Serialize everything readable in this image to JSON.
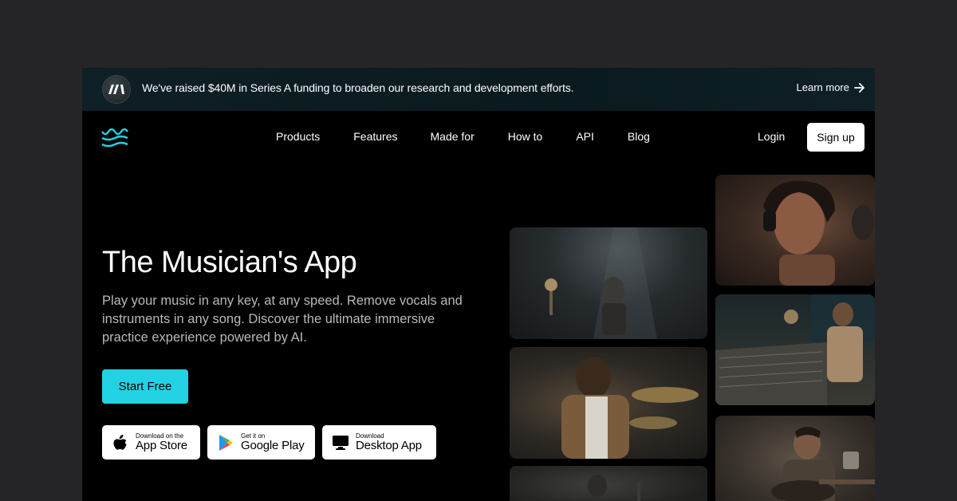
{
  "banner": {
    "text": "We've raised $40M in Series A funding to broaden our research and development efforts.",
    "link": "Learn more"
  },
  "nav": {
    "links": [
      "Products",
      "Features",
      "Made for",
      "How to",
      "API",
      "Blog"
    ],
    "login": "Login",
    "signup": "Sign up"
  },
  "hero": {
    "title": "The Musician's App",
    "subtitle": "Play your music in any key, at any speed. Remove vocals and instruments in any song. Discover the ultimate immersive practice experience powered by AI.",
    "cta": "Start Free"
  },
  "stores": [
    {
      "small": "Download on the",
      "big": "App Store",
      "icon": "apple-icon"
    },
    {
      "small": "Get it on",
      "big": "Google Play",
      "icon": "google-play-icon"
    },
    {
      "small": "Download",
      "big": "Desktop App",
      "icon": "desktop-icon"
    }
  ],
  "colors": {
    "accent": "#22d2e2",
    "background": "#000000",
    "page_background": "#252528",
    "banner": "#0e1f25"
  }
}
